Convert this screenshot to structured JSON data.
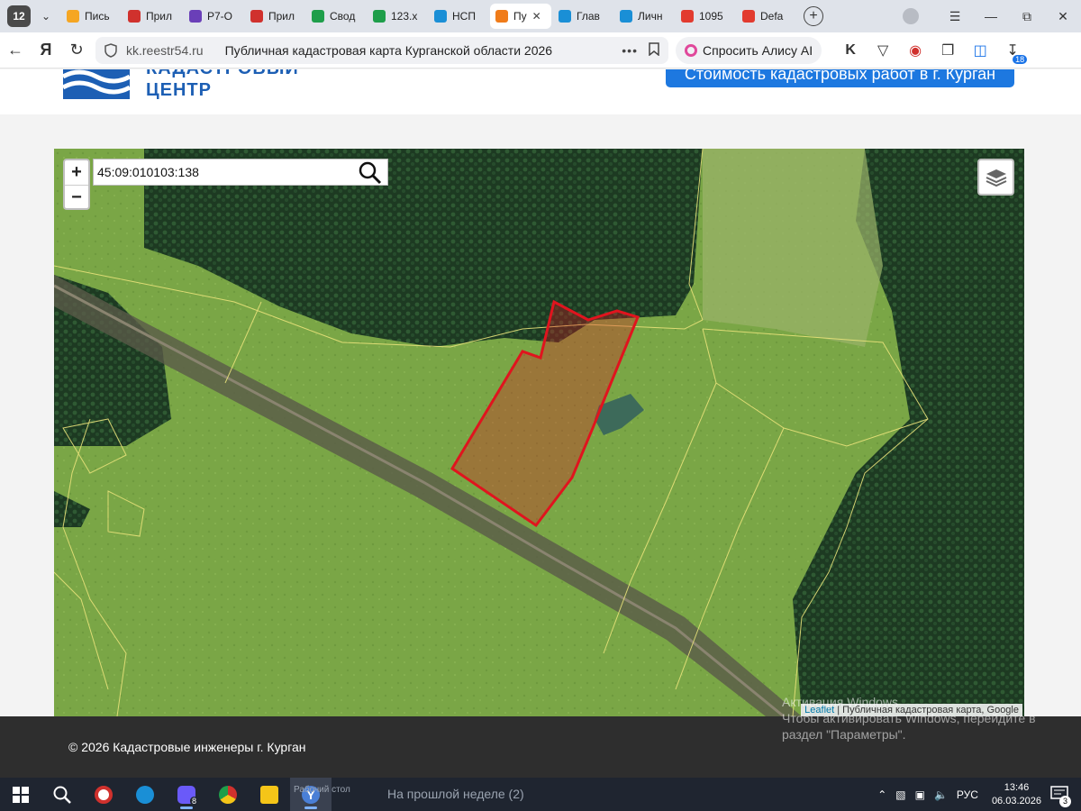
{
  "browser": {
    "tab_count": "12",
    "tabs": [
      {
        "label": "Пись",
        "color": "#f5a623"
      },
      {
        "label": "Прил",
        "color": "#d0312d"
      },
      {
        "label": "Р7-О",
        "color": "#6a3fb8"
      },
      {
        "label": "Прил",
        "color": "#d0312d"
      },
      {
        "label": "Свод",
        "color": "#1e9e4a"
      },
      {
        "label": "123.x",
        "color": "#1e9e4a"
      },
      {
        "label": "НСП",
        "color": "#1a8fd6"
      },
      {
        "label": "Пу",
        "color": "#f07c1a",
        "active": true
      },
      {
        "label": "Глав",
        "color": "#1a8fd6"
      },
      {
        "label": "Личн",
        "color": "#1a8fd6"
      },
      {
        "label": "1095",
        "color": "#e23b2f"
      },
      {
        "label": "Defa",
        "color": "#e23b2f"
      }
    ],
    "url_domain": "kk.reestr54.ru",
    "page_title": "Публичная кадастровая карта Курганской области 2026",
    "alice_button": "Спросить Алису AI",
    "extension_badge": "18"
  },
  "site": {
    "logo_line1": "КАДАСТРОВЫЙ",
    "logo_line2": "ЦЕНТР",
    "cta_button": "Стоимость кадастровых работ в г. Курган",
    "brand_color": "#1d5fb4"
  },
  "map": {
    "search_value": "45:09:010103:138",
    "zoom_in": "+",
    "zoom_out": "−",
    "attribution_leaflet": "Leaflet",
    "attribution_rest": " | Публичная кадастровая карта, Google",
    "highlight_color": "#e0141e"
  },
  "footer": {
    "copyright": "© 2026 Кадастровые инженеры г. Курган"
  },
  "watermark": {
    "line1": "Активация Windows",
    "line2": "Чтобы активировать Windows, перейдите в",
    "line3": "раздел \"Параметры\"."
  },
  "taskbar": {
    "ghost_text": "На прошлой неделе (2)",
    "ghost_text2": "Рабочий стол",
    "language": "РУС",
    "time": "13:46",
    "date": "06.03.2026",
    "notifications": "3",
    "app_badge": "8"
  }
}
